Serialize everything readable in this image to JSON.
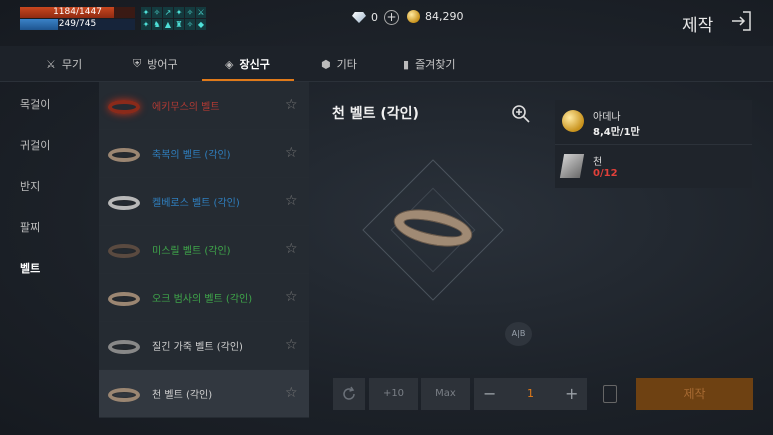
{
  "player": {
    "hp_text": "1184/1447",
    "hp_fraction": 0.818,
    "mp_text": "249/745",
    "mp_fraction": 0.334
  },
  "buff_icons": [
    "buff-icon",
    "buff-icon",
    "buff-icon",
    "buff-icon",
    "buff-icon",
    "buff-icon",
    "buff-icon",
    "buff-icon",
    "buff-icon",
    "buff-icon",
    "buff-icon",
    "buff-icon"
  ],
  "currencies": {
    "diamond_count": "0",
    "adena_count": "84,290"
  },
  "header": {
    "title": "제작"
  },
  "tabs": [
    {
      "label": "무기",
      "icon": "sword-icon"
    },
    {
      "label": "방어구",
      "icon": "shield-icon"
    },
    {
      "label": "장신구",
      "icon": "accessory-icon"
    },
    {
      "label": "기타",
      "icon": "cube-icon"
    },
    {
      "label": "즐겨찾기",
      "icon": "bookmark-icon"
    }
  ],
  "categories": [
    {
      "label": "목걸이"
    },
    {
      "label": "귀걸이"
    },
    {
      "label": "반지"
    },
    {
      "label": "팔찌"
    },
    {
      "label": "벨트"
    }
  ],
  "items": [
    {
      "name": "에키무스의 벨트",
      "color": "#b03a34"
    },
    {
      "name": "축복의 벨트 (각인)",
      "color": "#2f7fbf"
    },
    {
      "name": "켈베로스 벨트 (각인)",
      "color": "#2f7fbf"
    },
    {
      "name": "미스릴 벨트 (각인)",
      "color": "#3fa64a"
    },
    {
      "name": "오크 범사의 벨트 (각인)",
      "color": "#3fa64a"
    },
    {
      "name": "질긴 가죽 벨트 (각인)",
      "color": "#d0d0d0"
    },
    {
      "name": "천 벨트 (각인)",
      "color": "#d0d0d0"
    }
  ],
  "detail": {
    "title": "천 벨트 (각인)",
    "ab_label": "A|B"
  },
  "materials": [
    {
      "name": "아데나",
      "value": "8,4만/1만",
      "icon": "adena-coin-icon",
      "sufficient": true
    },
    {
      "name": "천",
      "value": "0/12",
      "icon": "cloth-icon",
      "sufficient": false
    }
  ],
  "controls": {
    "plus10_label": "+10",
    "max_label": "Max",
    "minus_label": "−",
    "plus_label": "+",
    "quantity": "1",
    "craft_label": "제작"
  },
  "colors": {
    "accent": "#e07a1a",
    "hp": "#c9471f",
    "mp": "#3a82c8",
    "insufficient": "#e0403a"
  }
}
